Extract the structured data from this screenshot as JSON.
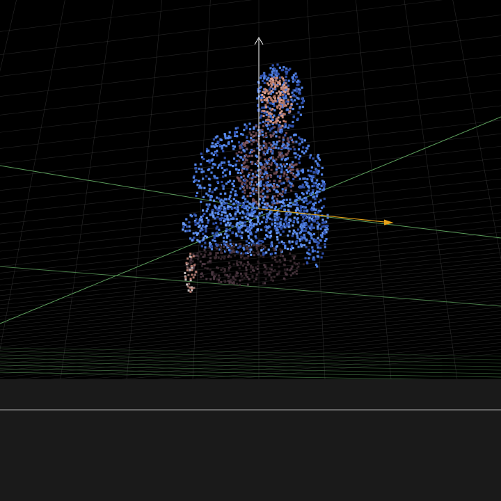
{
  "viewer": {
    "background_color": "#000000",
    "floor_color": "#1a1a1a",
    "grid_color": "#4a4a4a",
    "grid_axis_color": "#5c9e5c",
    "horizon_line_color": "#b0b0b0"
  },
  "axes": {
    "vertical_color": "#ffffff",
    "x_axis_color": "#e6a21a",
    "ground_axis_color": "#5c9e5c"
  },
  "point_cloud": {
    "subject": "seated-person-in-hoodie",
    "colors": {
      "hoodie": "#4f7fe0",
      "hoodie_dark": "#2f4fa8",
      "face": "#c98a78",
      "shirt": "#6e4a52",
      "legs": "#3a2a30",
      "hand": "#b37a6e"
    }
  }
}
